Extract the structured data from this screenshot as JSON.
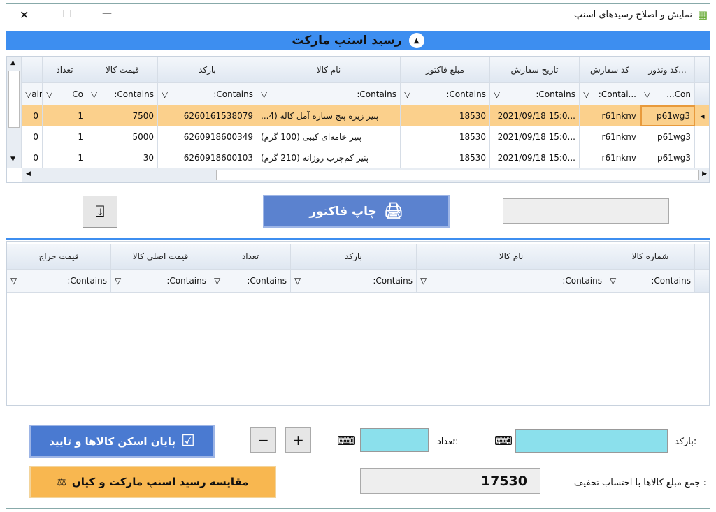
{
  "window": {
    "title": "نمایش و اصلاح رسیدهای اسنپ",
    "close": "✕",
    "maximize": "☐",
    "minimize": "—"
  },
  "header_bar": {
    "title": "رسید اسنپ مارکت",
    "collapse_icon": "chevron-up-icon"
  },
  "grid1": {
    "columns": [
      "کد وندور...",
      "کد سفارش",
      "تاریخ سفارش",
      "مبلغ فاکتور",
      "نام کالا",
      "بارکد",
      "قیمت کالا",
      "تعداد",
      ""
    ],
    "filters": [
      "...Con",
      ":Contai...",
      ":Contains",
      ":Contains",
      ":Contains",
      ":Contains",
      ":Contains",
      "Co",
      "ains"
    ],
    "rows": [
      [
        "p61wg3",
        "r61nknv",
        "2021/09/18 15:0...",
        "18530",
        "پنیر زیره پنج ستاره آمل کاله (4...",
        "6260161538079",
        "7500",
        "1",
        "0"
      ],
      [
        "p61wg3",
        "r61nknv",
        "2021/09/18 15:0...",
        "18530",
        "پنیر خامه‌ای کیبی (100 گرم)",
        "6260918600349",
        "5000",
        "1",
        "0"
      ],
      [
        "p61wg3",
        "r61nknv",
        "2021/09/18 15:0...",
        "18530",
        "پنیر کم‌چرب روزانه (210 گرم)",
        "6260918600103",
        "30",
        "1",
        "0"
      ]
    ],
    "selected_row": 0
  },
  "print_button": {
    "label": "چاپ فاکتور",
    "icon": "printer-icon"
  },
  "side_textbox": {
    "value": ""
  },
  "import_button": {
    "icon": "arrow-into-box-icon"
  },
  "grid2": {
    "columns": [
      "شماره کالا",
      "نام کالا",
      "بارکد",
      "تعداد",
      "قیمت اصلی کالا",
      "قیمت حراج"
    ],
    "filters": [
      ":Contains",
      ":Contains",
      ":Contains",
      ":Contains",
      ":Contains",
      ":Contains"
    ]
  },
  "bottom": {
    "barcode_label": "بارکد:",
    "barcode_value": "",
    "qty_label": "تعداد:",
    "qty_value": "",
    "finish_button": "پایان اسکن کالاها و تایید",
    "compare_button": "مقایسه رسید اسنپ مارکت و کیان",
    "total_label": "جمع مبلغ کالاها با احتساب تخفیف :",
    "total_value": "17530",
    "plus": "+",
    "minus": "−"
  },
  "colors": {
    "header_blue": "#3d8ef0",
    "selected_row": "#fbd08c",
    "finish_btn": "#4a7ad1",
    "compare_btn": "#f8b750",
    "input_cyan": "#8be0ec"
  }
}
